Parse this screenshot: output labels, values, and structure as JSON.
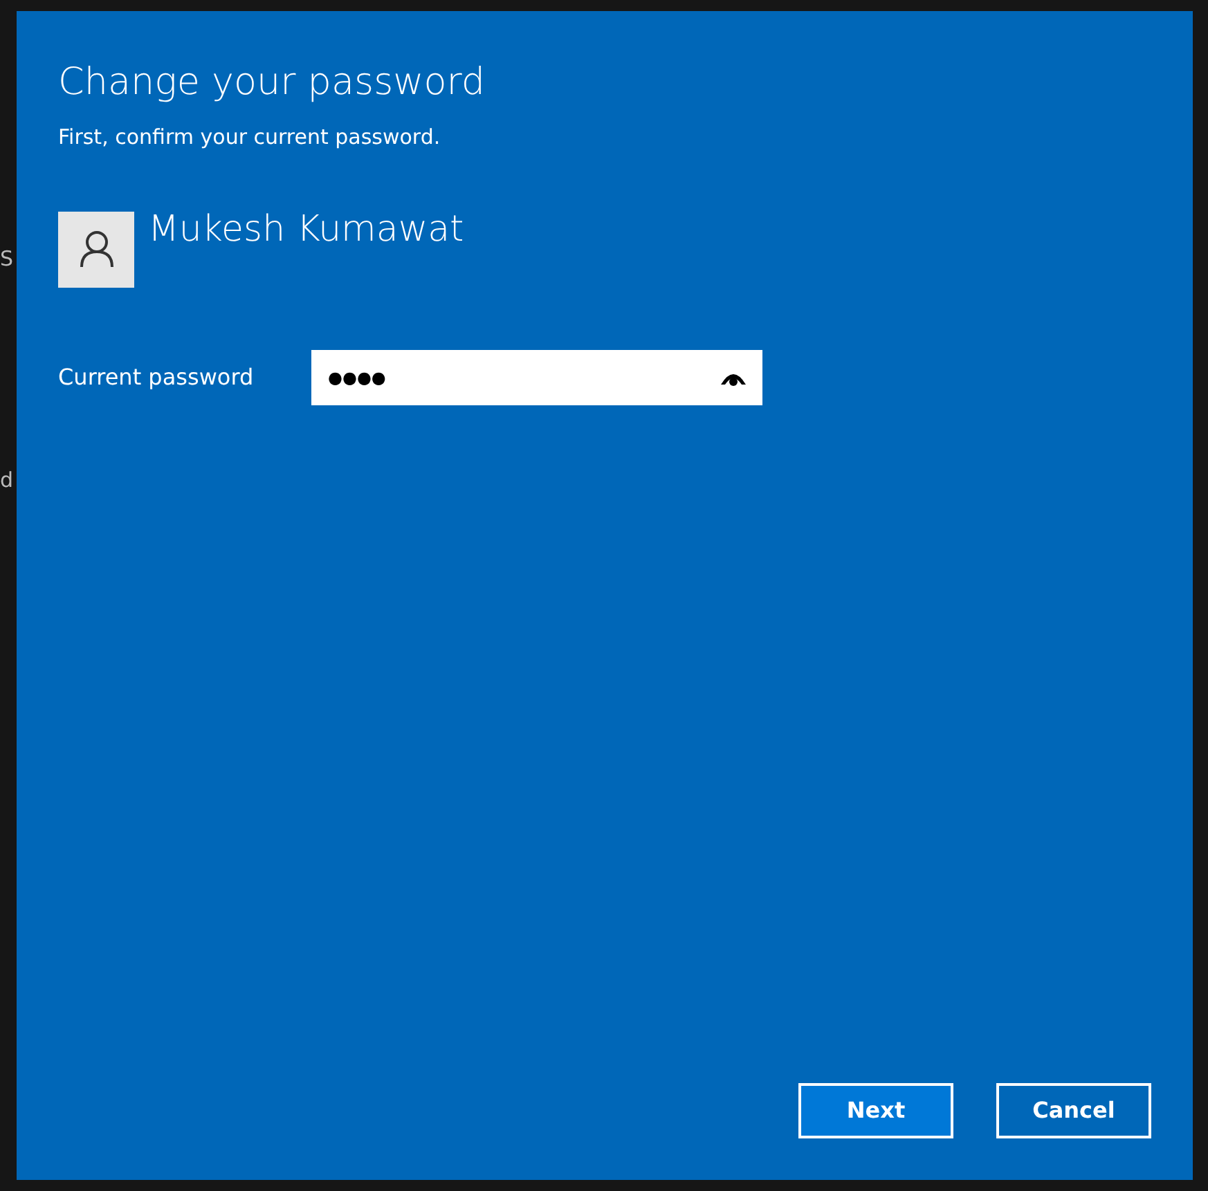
{
  "background": {
    "fragments": [
      "S",
      "d"
    ]
  },
  "dialog": {
    "title": "Change your password",
    "subtitle": "First, confirm your current password.",
    "user": {
      "name": "Mukesh Kumawat"
    },
    "field": {
      "label": "Current password",
      "value": "●●●●"
    },
    "buttons": [
      {
        "label": "Next",
        "kind": "primary"
      },
      {
        "label": "Cancel",
        "kind": "secondary"
      }
    ]
  }
}
